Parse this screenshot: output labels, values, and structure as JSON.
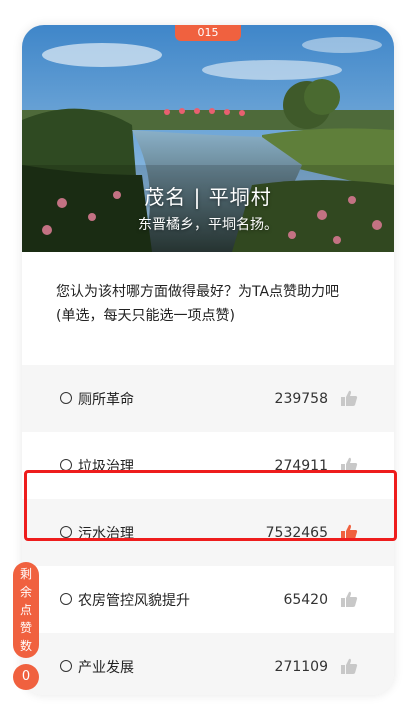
{
  "badge": "015",
  "hero": {
    "title": "茂名 | 平垌村",
    "subtitle": "东晋橘乡，平垌名扬。"
  },
  "question": {
    "line1": "您认为该村哪方面做得最好？为TA点赞助力吧",
    "line2": "(单选，每天只能选一项点赞)"
  },
  "options": [
    {
      "label": "厕所革命",
      "count": "239758",
      "thumb_color": "#c8c8c8"
    },
    {
      "label": "垃圾治理",
      "count": "274911",
      "thumb_color": "#c8c8c8"
    },
    {
      "label": "污水治理",
      "count": "7532465",
      "thumb_color": "#f0613f"
    },
    {
      "label": "农房管控风貌提升",
      "count": "65420",
      "thumb_color": "#c8c8c8"
    },
    {
      "label": "产业发展",
      "count": "271109",
      "thumb_color": "#c8c8c8"
    }
  ],
  "remaining": {
    "chars": [
      "剩",
      "余",
      "点",
      "赞",
      "数"
    ],
    "count": "0"
  },
  "colors": {
    "accent": "#f0613f",
    "highlight": "#ee1d1d"
  }
}
